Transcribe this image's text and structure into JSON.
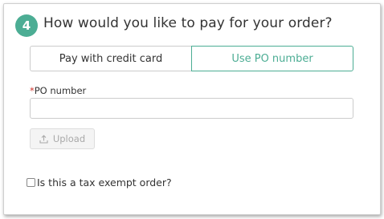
{
  "step": {
    "number": "4",
    "title": "How would you like to pay for your order?"
  },
  "payment_toggle": {
    "options": [
      {
        "label": "Pay with credit card",
        "selected": false
      },
      {
        "label": "Use PO number",
        "selected": true
      }
    ]
  },
  "po_field": {
    "required_marker": "*",
    "label": "PO number",
    "value": "",
    "placeholder": ""
  },
  "upload": {
    "label": "Upload",
    "icon": "upload-icon",
    "disabled": true
  },
  "tax_exempt": {
    "label": "Is this a tax exempt order?",
    "checked": false
  },
  "colors": {
    "accent": "#4cad94",
    "required": "#d0342c",
    "text": "#333333"
  }
}
